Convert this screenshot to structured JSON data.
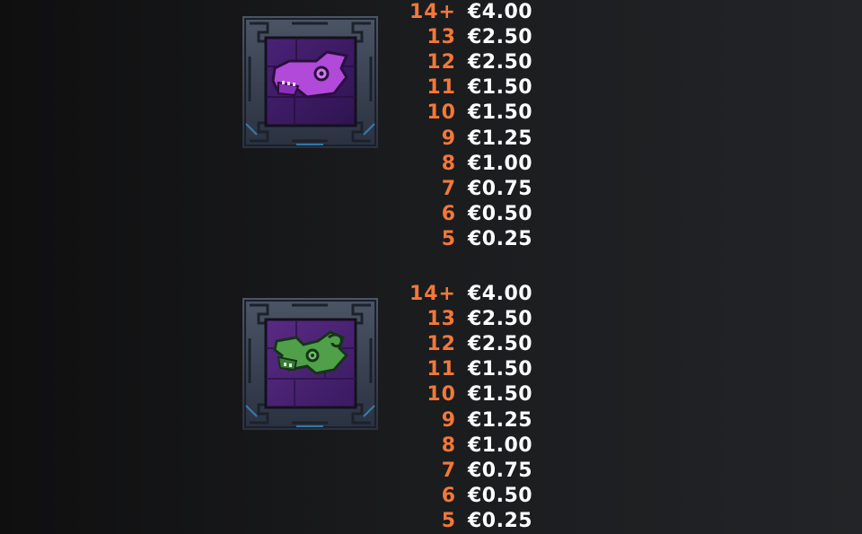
{
  "symbols": [
    {
      "icon": "purple-serpent-head-icon",
      "accent_color": "#8a32c4",
      "payouts": [
        {
          "count": "14+",
          "value": "€4.00"
        },
        {
          "count": "13",
          "value": "€2.50"
        },
        {
          "count": "12",
          "value": "€2.50"
        },
        {
          "count": "11",
          "value": "€1.50"
        },
        {
          "count": "10",
          "value": "€1.50"
        },
        {
          "count": "9",
          "value": "€1.25"
        },
        {
          "count": "8",
          "value": "€1.00"
        },
        {
          "count": "7",
          "value": "€0.75"
        },
        {
          "count": "6",
          "value": "€0.50"
        },
        {
          "count": "5",
          "value": "€0.25"
        }
      ]
    },
    {
      "icon": "green-serpent-head-icon",
      "accent_color": "#3f8f3a",
      "payouts": [
        {
          "count": "14+",
          "value": "€4.00"
        },
        {
          "count": "13",
          "value": "€2.50"
        },
        {
          "count": "12",
          "value": "€2.50"
        },
        {
          "count": "11",
          "value": "€1.50"
        },
        {
          "count": "10",
          "value": "€1.50"
        },
        {
          "count": "9",
          "value": "€1.25"
        },
        {
          "count": "8",
          "value": "€1.00"
        },
        {
          "count": "7",
          "value": "€0.75"
        },
        {
          "count": "6",
          "value": "€0.50"
        },
        {
          "count": "5",
          "value": "€0.25"
        }
      ]
    }
  ],
  "colors": {
    "count_text": "#f2783a",
    "value_text": "#ffffff"
  }
}
